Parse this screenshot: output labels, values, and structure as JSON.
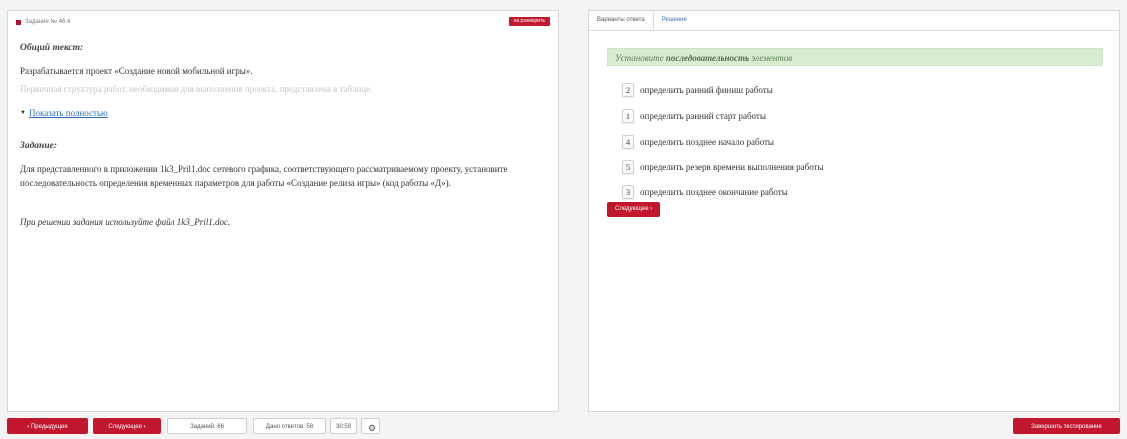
{
  "left": {
    "task_number": "Задание № 46.4",
    "expand_button": "на размерить",
    "general_title": "Общий текст:",
    "general_text": "Разрабатывается проект «Создание новой мобильной игры».",
    "general_faded": "Первичная структура работ, необходимая для выполнения проекта, представлена в таблице.",
    "show_more": "Показать полностью",
    "task_title": "Задание:",
    "task_text": "Для представленного в приложении 1k3_Pril1.doc сетевого графика, соответствующего рассматриваемому проекту, установите последовательность определения временных параметров для работы «Создание релиза игры» (код работы «Д»).",
    "task_hint": "При решении задания используйте файл 1k3_Pril1.doc."
  },
  "right": {
    "tabs": [
      "Варианты ответа",
      "Решение"
    ],
    "banner_prefix": "Установите",
    "banner_bold": "последовательность",
    "banner_suffix": "элементов",
    "items": [
      {
        "num": "2",
        "text": "определить ранний финиш работы"
      },
      {
        "num": "1",
        "text": "определить ранний старт работы"
      },
      {
        "num": "4",
        "text": "определить позднее начало работы"
      },
      {
        "num": "5",
        "text": "определить резерв времени выполнения работы"
      },
      {
        "num": "3",
        "text": "определить позднее окончание работы"
      }
    ],
    "next_button": "Следующее ›"
  },
  "bottom": {
    "prev": "‹ Предыдущее",
    "next": "Следующее ›",
    "tasks": "Заданий: 66",
    "answered": "Дано ответов: 58",
    "timer": "30:59",
    "settings_icon": "⚙",
    "finish": "Завершить тестирование"
  },
  "colors": {
    "accent": "#c2182f",
    "banner": "#d9ecd1",
    "link": "#2a6bb5"
  }
}
